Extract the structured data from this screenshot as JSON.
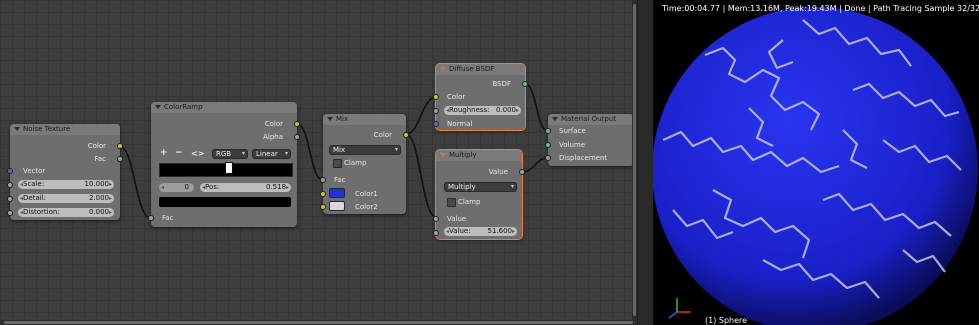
{
  "noise": {
    "title": "Noise Texture",
    "out_color": "Color",
    "out_fac": "Fac",
    "in_vector": "Vector",
    "scale_label": "Scale:",
    "scale_value": "10.000",
    "detail_label": "Detail:",
    "detail_value": "2.000",
    "distortion_label": "Distortion:",
    "distortion_value": "0.000"
  },
  "ramp": {
    "title": "ColorRamp",
    "out_color": "Color",
    "out_alpha": "Alpha",
    "plus": "+",
    "minus": "−",
    "flip": "<>",
    "color_mode": "RGB",
    "interpolation": "Linear",
    "index": "0",
    "pos_label": "Pos:",
    "pos_value": "0.518",
    "in_fac": "Fac"
  },
  "mix": {
    "title": "Mix",
    "out_color": "Color",
    "blend": "Mix",
    "clamp": "Clamp",
    "fac": "Fac",
    "color1": "Color1",
    "color2": "Color2",
    "color1_hex": "#2531d6",
    "color2_hex": "#d9d9d9"
  },
  "diffuse": {
    "title": "Diffuse BSDF",
    "out_bsdf": "BSDF",
    "in_color": "Color",
    "roughness_label": "Roughness:",
    "roughness_value": "0.000",
    "in_normal": "Normal"
  },
  "multiply": {
    "title": "Multiply",
    "out_value": "Value",
    "operation": "Multiply",
    "clamp": "Clamp",
    "in_value": "Value",
    "value_label": "Value:",
    "value_value": "51.600"
  },
  "output": {
    "title": "Material Output",
    "surface": "Surface",
    "volume": "Volume",
    "displacement": "Displacement"
  },
  "viewport": {
    "stats": "Time:00:04.77 | Mem:13.16M, Peak:19.43M | Done | Path Tracing Sample 32/32",
    "object": "(1) Sphere",
    "sphere_color": "#1d22d8"
  }
}
